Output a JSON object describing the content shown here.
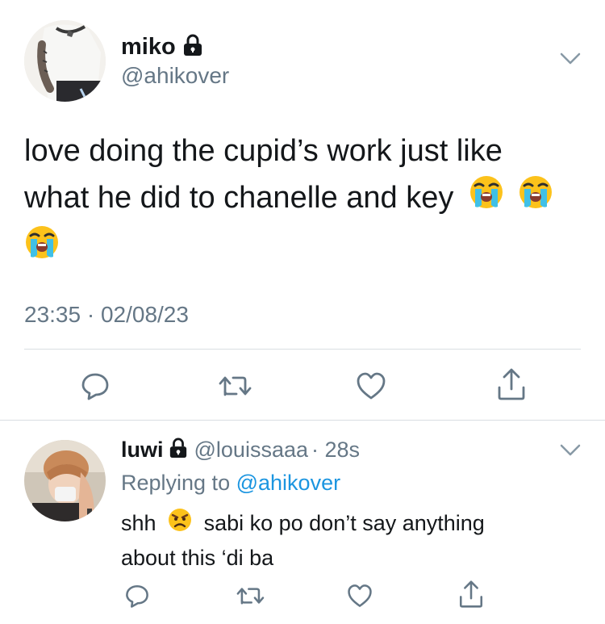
{
  "main_tweet": {
    "name": "miko",
    "handle": "@ahikover",
    "text_line1": "love doing the cupid’s work just like",
    "text_line2": "what he did to chanelle and key",
    "timestamp": "23:35 · 02/08/23",
    "emoji": "loudly-crying-face"
  },
  "reply_tweet": {
    "name": "luwi",
    "handle": "@louissaaa",
    "time": "· 28s",
    "replying_label": "Replying to",
    "replying_mention": "@ahikover",
    "text_part1": "shh",
    "text_part2": "sabi ko po don’t say anything",
    "text_line2": "about this ‘di ba",
    "emoji": "angry-face"
  },
  "actions": [
    "reply-icon",
    "retweet-icon",
    "like-icon",
    "share-icon"
  ],
  "colors": {
    "text": "#14171a",
    "secondary": "#657786",
    "link": "#1b95e0",
    "divider": "#d9dee2"
  }
}
